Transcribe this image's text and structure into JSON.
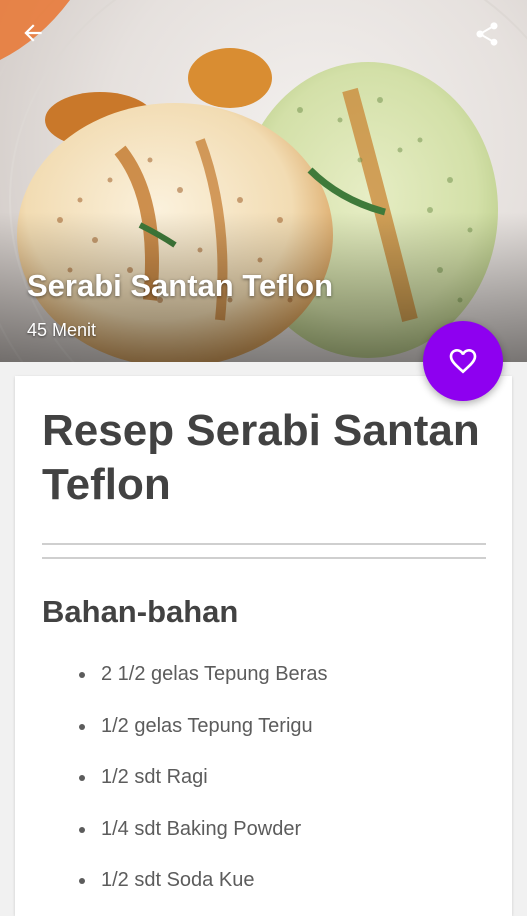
{
  "header": {
    "back_icon": "arrow-back-icon",
    "share_icon": "share-icon",
    "title": "Serabi Santan Teflon",
    "duration": "45 Menit"
  },
  "favorite": {
    "icon": "heart-outline-icon",
    "color": "#8e00f0"
  },
  "recipe": {
    "title": "Resep Serabi Santan Teflon",
    "section_title": "Bahan-bahan",
    "ingredients": [
      "2 1/2 gelas Tepung Beras",
      "1/2 gelas Tepung Terigu",
      "1/2 sdt Ragi",
      "1/4 sdt Baking Powder",
      "1/2 sdt Soda Kue"
    ]
  }
}
